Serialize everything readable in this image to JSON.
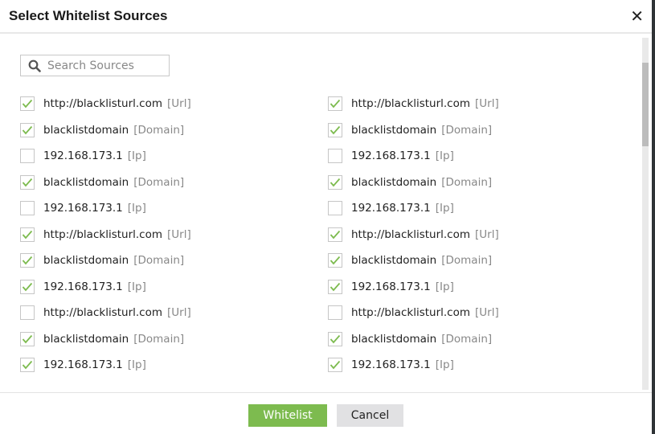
{
  "dialog": {
    "title": "Select Whitelist Sources",
    "close_icon": "close-icon"
  },
  "search": {
    "placeholder": "Search Sources",
    "value": ""
  },
  "colors": {
    "check": "#7dbb4f",
    "primary": "#7dbb4f"
  },
  "columns": [
    {
      "items": [
        {
          "name": "http://blacklisturl.com",
          "type": "[Url]",
          "checked": true
        },
        {
          "name": "blacklistdomain",
          "type": "[Domain]",
          "checked": true
        },
        {
          "name": "192.168.173.1",
          "type": "[Ip]",
          "checked": false
        },
        {
          "name": "blacklistdomain",
          "type": "[Domain]",
          "checked": true
        },
        {
          "name": "192.168.173.1",
          "type": "[Ip]",
          "checked": false
        },
        {
          "name": "http://blacklisturl.com",
          "type": "[Url]",
          "checked": true
        },
        {
          "name": "blacklistdomain",
          "type": "[Domain]",
          "checked": true
        },
        {
          "name": "192.168.173.1",
          "type": "[Ip]",
          "checked": true
        },
        {
          "name": "http://blacklisturl.com",
          "type": "[Url]",
          "checked": false
        },
        {
          "name": "blacklistdomain",
          "type": "[Domain]",
          "checked": true
        },
        {
          "name": "192.168.173.1",
          "type": "[Ip]",
          "checked": true
        }
      ]
    },
    {
      "items": [
        {
          "name": "http://blacklisturl.com",
          "type": "[Url]",
          "checked": true
        },
        {
          "name": "blacklistdomain",
          "type": "[Domain]",
          "checked": true
        },
        {
          "name": "192.168.173.1",
          "type": "[Ip]",
          "checked": false
        },
        {
          "name": "blacklistdomain",
          "type": "[Domain]",
          "checked": true
        },
        {
          "name": "192.168.173.1",
          "type": "[Ip]",
          "checked": false
        },
        {
          "name": "http://blacklisturl.com",
          "type": "[Url]",
          "checked": true
        },
        {
          "name": "blacklistdomain",
          "type": "[Domain]",
          "checked": true
        },
        {
          "name": "192.168.173.1",
          "type": "[Ip]",
          "checked": true
        },
        {
          "name": "http://blacklisturl.com",
          "type": "[Url]",
          "checked": false
        },
        {
          "name": "blacklistdomain",
          "type": "[Domain]",
          "checked": true
        },
        {
          "name": "192.168.173.1",
          "type": "[Ip]",
          "checked": true
        }
      ]
    }
  ],
  "footer": {
    "whitelist_label": "Whitelist",
    "cancel_label": "Cancel"
  }
}
